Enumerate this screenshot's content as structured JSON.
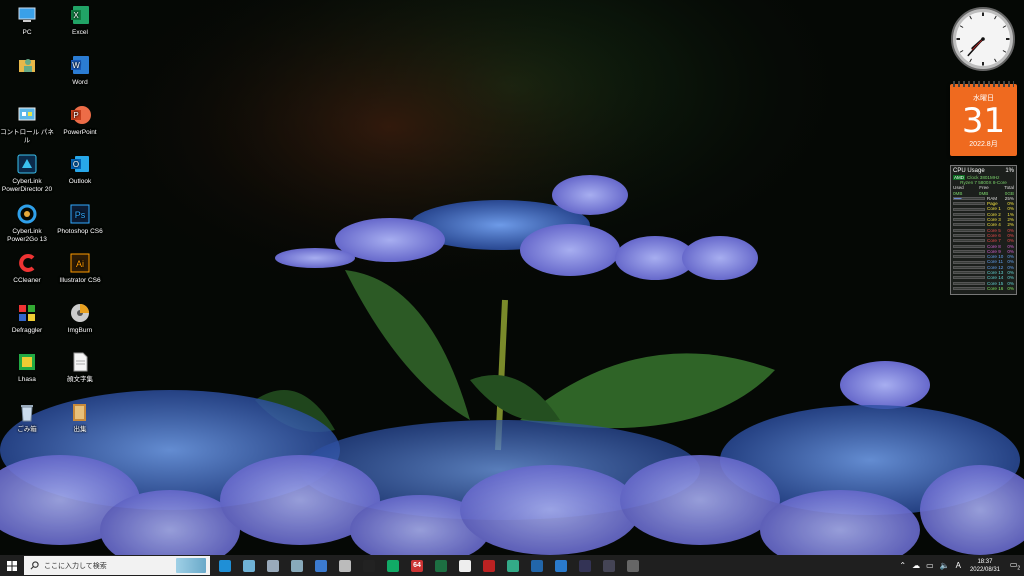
{
  "desktop": {
    "icons": [
      {
        "label": "PC",
        "icon": "pc-icon"
      },
      {
        "label": "Excel",
        "icon": "excel-icon"
      },
      {
        "label": "",
        "icon": "user-folder-icon"
      },
      {
        "label": "Word",
        "icon": "word-icon"
      },
      {
        "label": "コントロール パネル",
        "icon": "control-panel-icon"
      },
      {
        "label": "PowerPoint",
        "icon": "powerpoint-icon"
      },
      {
        "label": "CyberLink\nPowerDirector 20",
        "icon": "powerdirector-icon"
      },
      {
        "label": "Outlook",
        "icon": "outlook-icon"
      },
      {
        "label": "CyberLink\nPower2Go 13",
        "icon": "power2go-icon"
      },
      {
        "label": "Photoshop CS6",
        "icon": "photoshop-icon"
      },
      {
        "label": "CCleaner",
        "icon": "ccleaner-icon"
      },
      {
        "label": "Illustrator CS6",
        "icon": "illustrator-icon"
      },
      {
        "label": "Defraggler",
        "icon": "defraggler-icon"
      },
      {
        "label": "ImgBurn",
        "icon": "imgburn-icon"
      },
      {
        "label": "Lhasa",
        "icon": "lhasa-icon"
      },
      {
        "label": "顔文字集",
        "icon": "text-file-icon"
      },
      {
        "label": "ごみ箱",
        "icon": "recycle-bin-icon"
      },
      {
        "label": "出集",
        "icon": "folder-icon"
      }
    ]
  },
  "gadgets": {
    "clock": {
      "hour": 7,
      "minute": 37
    },
    "calendar": {
      "weekday": "水曜日",
      "day": "31",
      "month": "2022.8月"
    },
    "cpu": {
      "title": "CPU Usage",
      "total": "1%",
      "brand": "AMD",
      "clock": "Clock 3801MHz",
      "model": "Ryzen 7 5800X 8-Core",
      "mem_headers": [
        "Used",
        "Free",
        "Total"
      ],
      "mem_values": [
        "0MB",
        "0MB",
        "0GB"
      ],
      "ram": {
        "label": "RAM",
        "value": "25%"
      },
      "page": {
        "label": "Page",
        "value": "0%"
      },
      "cores": [
        {
          "name": "Core 1",
          "value": "0%",
          "color": "#f0e040"
        },
        {
          "name": "Core 2",
          "value": "1%",
          "color": "#f0e040"
        },
        {
          "name": "Core 3",
          "value": "2%",
          "color": "#f0e040"
        },
        {
          "name": "Core 4",
          "value": "2%",
          "color": "#f0e040"
        },
        {
          "name": "Core 5",
          "value": "0%",
          "color": "#e84a4a"
        },
        {
          "name": "Core 6",
          "value": "0%",
          "color": "#e84a4a"
        },
        {
          "name": "Core 7",
          "value": "0%",
          "color": "#e84a4a"
        },
        {
          "name": "Core 8",
          "value": "0%",
          "color": "#d060d0"
        },
        {
          "name": "Core 9",
          "value": "0%",
          "color": "#d060d0"
        },
        {
          "name": "Core 10",
          "value": "0%",
          "color": "#60a0f0"
        },
        {
          "name": "Core 11",
          "value": "0%",
          "color": "#60a0f0"
        },
        {
          "name": "Core 12",
          "value": "0%",
          "color": "#60a0f0"
        },
        {
          "name": "Core 13",
          "value": "0%",
          "color": "#60d0d0"
        },
        {
          "name": "Core 14",
          "value": "0%",
          "color": "#60d0d0"
        },
        {
          "name": "Core 15",
          "value": "0%",
          "color": "#60d0d0"
        },
        {
          "name": "Core 16",
          "value": "0%",
          "color": "#80e060"
        }
      ]
    }
  },
  "taskbar": {
    "search_placeholder": "ここに入力して検索",
    "apps": [
      {
        "icon": "edge-icon",
        "color": "#1f8fd6"
      },
      {
        "icon": "explorer-icon",
        "color": "#6fb2d6"
      },
      {
        "icon": "disk-icon",
        "color": "#9ab"
      },
      {
        "icon": "network-icon",
        "color": "#8ab"
      },
      {
        "icon": "calculator-icon",
        "color": "#3c7bd0"
      },
      {
        "icon": "notepad-icon",
        "color": "#bbb"
      },
      {
        "icon": "terminal-icon",
        "color": "#222"
      },
      {
        "icon": "monitor-icon",
        "color": "#1a6"
      },
      {
        "icon": "app64-icon",
        "color": "#c33",
        "text": "64"
      },
      {
        "icon": "excel-small-icon",
        "color": "#1d6f42"
      },
      {
        "icon": "music-icon",
        "color": "#eee"
      },
      {
        "icon": "editor-icon",
        "color": "#b22"
      },
      {
        "icon": "photos-icon",
        "color": "#3a8"
      },
      {
        "icon": "browser-icon",
        "color": "#26a"
      },
      {
        "icon": "snowflake-icon",
        "color": "#2a7acc"
      },
      {
        "icon": "camera-icon",
        "color": "#335"
      },
      {
        "icon": "media-icon",
        "color": "#445"
      },
      {
        "icon": "settings-app-icon",
        "color": "#666"
      }
    ],
    "tray": {
      "ime": "A",
      "time": "18:37",
      "date": "2022/08/31",
      "notifications": "2"
    }
  }
}
